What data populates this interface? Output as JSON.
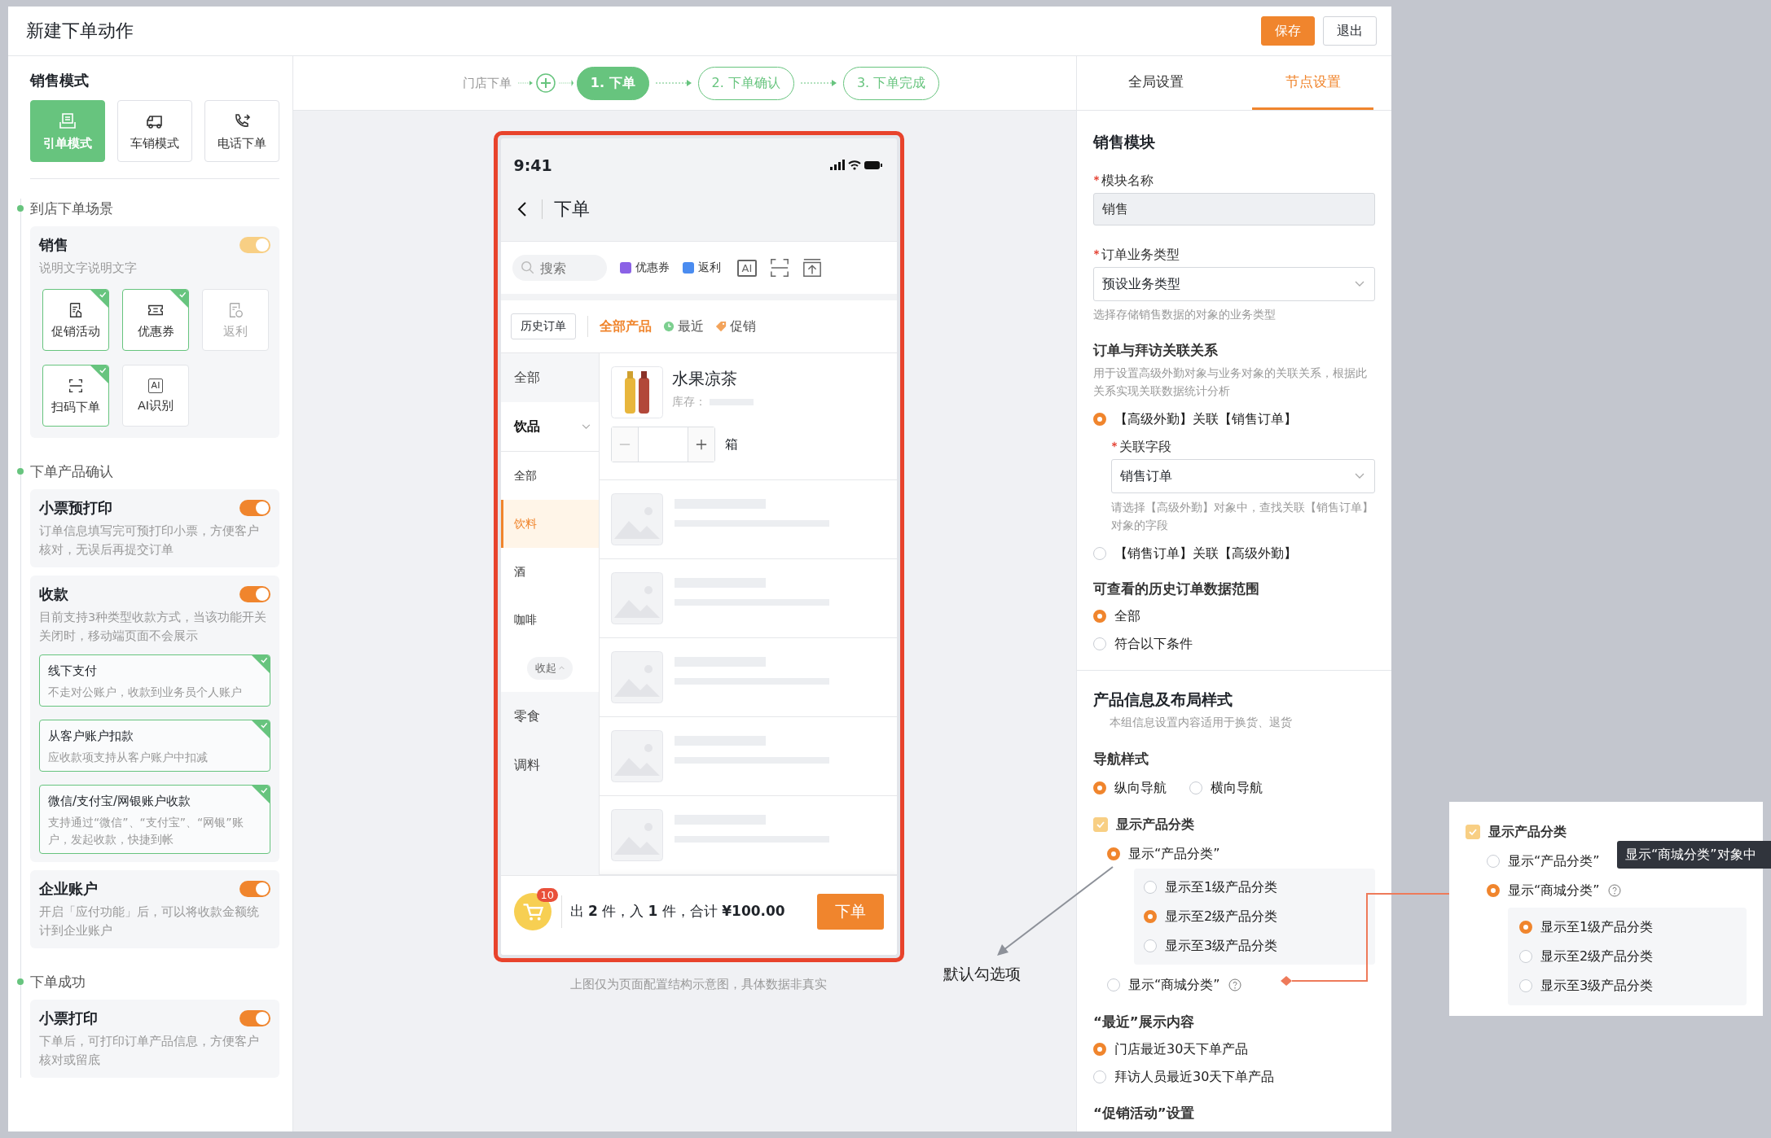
{
  "header": {
    "title": "新建下单动作",
    "buttons": [
      {
        "label": "保存",
        "kind": "primary"
      },
      {
        "label": "退出",
        "kind": "default"
      }
    ]
  },
  "sales_mode": {
    "title": "销售模式",
    "modes": [
      {
        "label": "引单模式",
        "selected": true
      },
      {
        "label": "车销模式",
        "selected": false
      },
      {
        "label": "电话下单",
        "selected": false
      }
    ]
  },
  "flow": [
    {
      "title": "到店下单场景",
      "cards": [
        {
          "title": "销售",
          "on": true,
          "disabled": true,
          "description": "说明文字说明文字",
          "features": [
            {
              "label": "促销活动",
              "checked": true,
              "disabled": false
            },
            {
              "label": "优惠券",
              "checked": true,
              "disabled": false
            },
            {
              "label": "返利",
              "checked": false,
              "disabled": true
            },
            {
              "label": "扫码下单",
              "checked": true,
              "disabled": false
            },
            {
              "label": "AI识别",
              "icon_text": "AI",
              "checked": false,
              "disabled": false
            }
          ]
        }
      ]
    },
    {
      "title": "下单产品确认",
      "cards": [
        {
          "title": "小票预打印",
          "on": true,
          "disabled": false,
          "description": "订单信息填写完可预打印小票，方便客户核对，无误后再提交订单"
        },
        {
          "title": "收款",
          "on": true,
          "disabled": false,
          "description": "目前支持3种类型收款方式，当该功能开关关闭时，移动端页面不会展示",
          "options": [
            {
              "title": "线下支付",
              "description": "不走对公账户，收款到业务员个人账户",
              "checked": true
            },
            {
              "title": "从客户账户扣款",
              "description": "应收款项支持从客户账户中扣减",
              "checked": true
            },
            {
              "title": "微信/支付宝/网银账户收款",
              "description": "支持通过“微信”、“支付宝”、“网银”账户，发起收款，快捷到帐",
              "checked": true
            }
          ]
        },
        {
          "title": "企业账户",
          "on": true,
          "disabled": false,
          "description": "开启「应付功能」后，可以将收款金额统计到企业账户"
        }
      ]
    },
    {
      "title": "下单成功",
      "cards": [
        {
          "title": "小票打印",
          "on": true,
          "disabled": false,
          "description": "下单后，可打印订单产品信息，方便客户核对或留底"
        }
      ]
    }
  ],
  "steps_bar": {
    "origin": "门店下单",
    "steps": [
      {
        "label": "1. 下单",
        "selected": true
      },
      {
        "label": "2. 下单确认",
        "selected": false
      },
      {
        "label": "3. 下单完成",
        "selected": false
      }
    ]
  },
  "phone": {
    "time": "9:41",
    "title": "下单",
    "search_placeholder": "搜索",
    "tools": [
      {
        "label": "优惠券",
        "color": "#8b62e6"
      },
      {
        "label": "返利",
        "color": "#4a8cf0"
      }
    ],
    "icon_buttons": [
      {
        "kind": "ai",
        "text": "AI"
      },
      {
        "kind": "scan"
      },
      {
        "kind": "upload"
      }
    ],
    "history_button": "历史订单",
    "tabs": [
      {
        "label": "全部产品",
        "selected": true,
        "kind": "plain"
      },
      {
        "label": "最近",
        "selected": false,
        "kind": "clock"
      },
      {
        "label": "促销",
        "selected": false,
        "kind": "tag"
      }
    ],
    "categories": [
      {
        "label": "全部",
        "selected": false
      },
      {
        "label": "饮品",
        "selected": false,
        "expanded": true,
        "collapse_label": "收起",
        "children": [
          {
            "label": "全部",
            "selected": false
          },
          {
            "label": "饮料",
            "selected": true
          },
          {
            "label": "酒",
            "selected": false
          },
          {
            "label": "咖啡",
            "selected": false
          }
        ]
      },
      {
        "label": "零食",
        "selected": false
      },
      {
        "label": "调料",
        "selected": false
      }
    ],
    "product": {
      "name": "水果凉茶",
      "stock_label": "库存：",
      "unit": "箱"
    },
    "cart_count": "10",
    "summary": "出 **2** 件，入 **1** 件，合计 **¥100.00**",
    "submit": "下单"
  },
  "caption": "上图仅为页面配置结构示意图，具体数据非真实",
  "settings": {
    "tabs": [
      {
        "label": "全局设置",
        "selected": false
      },
      {
        "label": "节点设置",
        "selected": true
      }
    ],
    "sales_module": {
      "title": "销售模块",
      "module_name": {
        "label": "模块名称",
        "required": true,
        "value": "销售",
        "disabled": true
      },
      "order_type": {
        "label": "订单业务类型",
        "required": true,
        "value": "预设业务类型",
        "hint": "选择存储销售数据的对象的业务类型"
      },
      "relation": {
        "label": "订单与拜访关联关系",
        "description": "用于设置高级外勤对象与业务对象的关联关系，根据此关系实现关联数据统计分析",
        "options": [
          {
            "label": "【高级外勤】关联【销售订单】",
            "selected": true,
            "field": {
              "label": "关联字段",
              "required": true,
              "value": "销售订单",
              "hint": "请选择【高级外勤】对象中，查找关联【销售订单】对象的字段"
            }
          },
          {
            "label": "【销售订单】关联【高级外勤】",
            "selected": false
          }
        ]
      },
      "history_range": {
        "label": "可查看的历史订单数据范围",
        "options": [
          {
            "label": "全部",
            "selected": true
          },
          {
            "label": "符合以下条件",
            "selected": false
          }
        ]
      }
    },
    "product_layout": {
      "title": "产品信息及布局样式",
      "description": "本组信息设置内容适用于换货、退货",
      "navigation": {
        "label": "导航样式",
        "options": [
          {
            "label": "纵向导航",
            "selected": true
          },
          {
            "label": "横向导航",
            "selected": false
          }
        ]
      },
      "show_category": {
        "label": "显示产品分类",
        "checked": true,
        "disabled": true,
        "options": [
          {
            "label": "显示“产品分类”",
            "selected": true,
            "help": false,
            "levels": [
              {
                "label": "显示至1级产品分类",
                "selected": false
              },
              {
                "label": "显示至2级产品分类",
                "selected": true
              },
              {
                "label": "显示至3级产品分类",
                "selected": false
              }
            ]
          },
          {
            "label": "显示“商城分类”",
            "selected": false,
            "help": true
          }
        ]
      },
      "recent": {
        "label": "“最近”展示内容",
        "options": [
          {
            "label": "门店最近30天下单产品",
            "selected": true
          },
          {
            "label": "拜访人员最近30天下单产品",
            "selected": false
          }
        ]
      },
      "promotion": {
        "label": "“促销活动”设置"
      }
    }
  },
  "annotation": {
    "label": "默认勾选项"
  },
  "callout": {
    "checkbox": {
      "label": "显示产品分类",
      "checked": true,
      "disabled": true
    },
    "options": [
      {
        "label": "显示“产品分类”",
        "selected": false,
        "help": false
      },
      {
        "label": "显示“商城分类”",
        "selected": true,
        "help": true,
        "levels": [
          {
            "label": "显示至1级产品分类",
            "selected": true
          },
          {
            "label": "显示至2级产品分类",
            "selected": false
          },
          {
            "label": "显示至3级产品分类",
            "selected": false
          }
        ]
      }
    ],
    "tooltip": "显示“商城分类”对象中"
  }
}
